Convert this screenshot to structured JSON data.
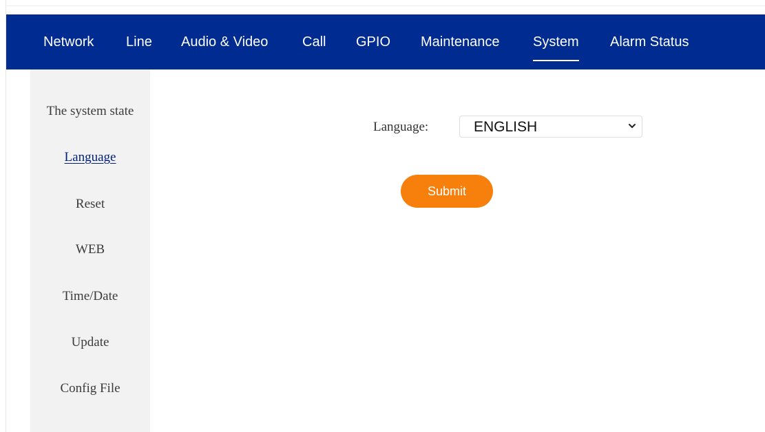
{
  "nav": {
    "items": [
      {
        "label": "Network"
      },
      {
        "label": "Line"
      },
      {
        "label": "Audio & Video"
      },
      {
        "label": "Call"
      },
      {
        "label": "GPIO"
      },
      {
        "label": "Maintenance"
      },
      {
        "label": "System",
        "active": true
      },
      {
        "label": "Alarm Status"
      }
    ],
    "bg_color": "#002b90"
  },
  "sidebar": {
    "items": [
      {
        "label": "The system state"
      },
      {
        "label": "Language",
        "active": true
      },
      {
        "label": "Reset"
      },
      {
        "label": "WEB"
      },
      {
        "label": "Time/Date"
      },
      {
        "label": "Update"
      },
      {
        "label": "Config File"
      }
    ]
  },
  "form": {
    "language_label": "Language:",
    "language_value": "ENGLISH",
    "submit_label": "Submit",
    "submit_color": "#f77f0b",
    "select_icon": "chevron-down-icon"
  }
}
